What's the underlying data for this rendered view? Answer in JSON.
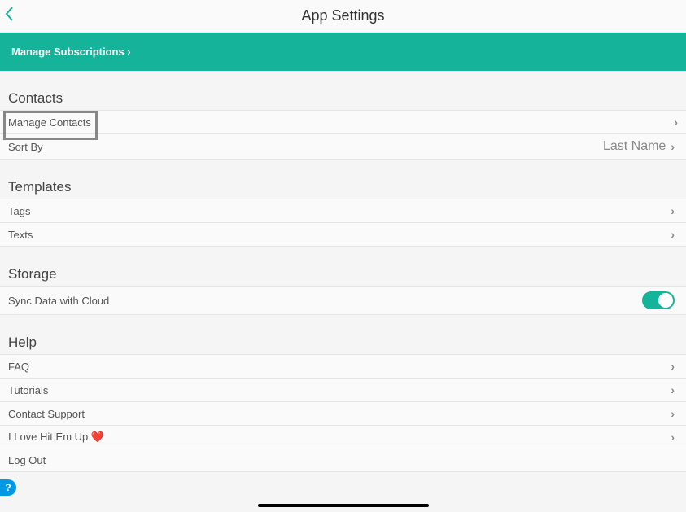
{
  "header": {
    "title": "App Settings"
  },
  "banner": {
    "label": "Manage Subscriptions ›"
  },
  "sections": {
    "contacts": {
      "title": "Contacts",
      "manage": "Manage Contacts",
      "sortByLabel": "Sort By",
      "sortByValue": "Last Name"
    },
    "templates": {
      "title": "Templates",
      "tags": "Tags",
      "texts": "Texts"
    },
    "storage": {
      "title": "Storage",
      "sync": "Sync Data with Cloud"
    },
    "help": {
      "title": "Help",
      "faq": "FAQ",
      "tutorials": "Tutorials",
      "contactSupport": "Contact Support",
      "love": "I Love Hit Em Up ❤️",
      "logout": "Log Out"
    }
  },
  "helpBubble": "?"
}
